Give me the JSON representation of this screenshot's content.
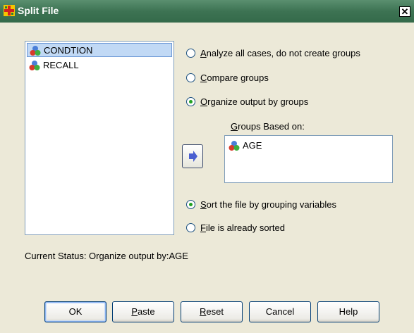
{
  "window": {
    "title": "Split File",
    "close_glyph": "✕"
  },
  "variable_list": {
    "items": [
      {
        "label": "CONDTION",
        "icon": "nominal-variable-icon",
        "selected": true
      },
      {
        "label": "RECALL",
        "icon": "nominal-variable-icon",
        "selected": false
      }
    ]
  },
  "options": {
    "analyze_all": {
      "first": "A",
      "rest": "nalyze all cases, do not create groups",
      "checked": false
    },
    "compare": {
      "first": "C",
      "rest": "ompare groups",
      "checked": false
    },
    "organize": {
      "first": "O",
      "rest": "rganize output by groups",
      "checked": true
    }
  },
  "groups": {
    "label_first": "G",
    "label_rest": "roups Based on:",
    "items": [
      {
        "label": "AGE",
        "icon": "nominal-variable-icon"
      }
    ]
  },
  "sort": {
    "sort_file": {
      "first": "S",
      "rest": "ort the file by grouping variables",
      "checked": true
    },
    "already_sorted": {
      "first": "F",
      "rest": "ile is already sorted",
      "checked": false
    }
  },
  "status": {
    "text": "Current Status: Organize output by:AGE"
  },
  "buttons": {
    "ok": "OK",
    "paste_first": "P",
    "paste_rest": "aste",
    "reset_first": "R",
    "reset_rest": "eset",
    "cancel": "Cancel",
    "help": "Help"
  },
  "colors": {
    "titlebar": "#3d7353",
    "accent_radio": "#21a121",
    "selection": "#c1d9f5",
    "arrow": "#4a5fd0"
  }
}
